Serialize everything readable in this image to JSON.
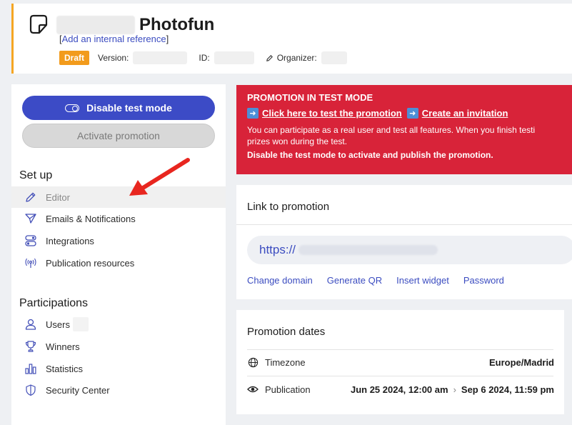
{
  "header": {
    "title": "Photofun",
    "ref_link": "Add an internal reference",
    "ref_open": "[",
    "ref_close": "]",
    "badge": "Draft",
    "version_label": "Version:",
    "id_label": "ID:",
    "organizer_label": "Organizer:"
  },
  "sidebar": {
    "disable_test_mode": "Disable test mode",
    "activate_promotion": "Activate promotion",
    "setup_title": "Set up",
    "setup_items": [
      "Editor",
      "Emails & Notifications",
      "Integrations",
      "Publication resources"
    ],
    "participations_title": "Participations",
    "participation_items": [
      "Users",
      "Winners",
      "Statistics",
      "Security Center"
    ]
  },
  "alert": {
    "title": "PROMOTION IN TEST MODE",
    "test_link": "Click here to test the promotion",
    "invite_link": "Create an invitation",
    "body_line1": "You can participate as a real user and test all features. When you finish testi",
    "body_line2": "prizes won during the test.",
    "strong": "Disable the test mode to activate and publish the promotion."
  },
  "link_card": {
    "title": "Link to promotion",
    "url_prefix": "https://",
    "actions": [
      "Change domain",
      "Generate QR",
      "Insert widget",
      "Password"
    ]
  },
  "dates_card": {
    "title": "Promotion dates",
    "timezone_label": "Timezone",
    "timezone_value": "Europe/Madrid",
    "publication_label": "Publication",
    "publication_start": "Jun 25 2024, 12:00 am",
    "publication_end": "Sep 6 2024, 11:59 pm"
  },
  "colors": {
    "accent": "#3c4bc6",
    "alert": "#d82339",
    "badge": "#f29b1c",
    "arrow": "#e8261f"
  }
}
